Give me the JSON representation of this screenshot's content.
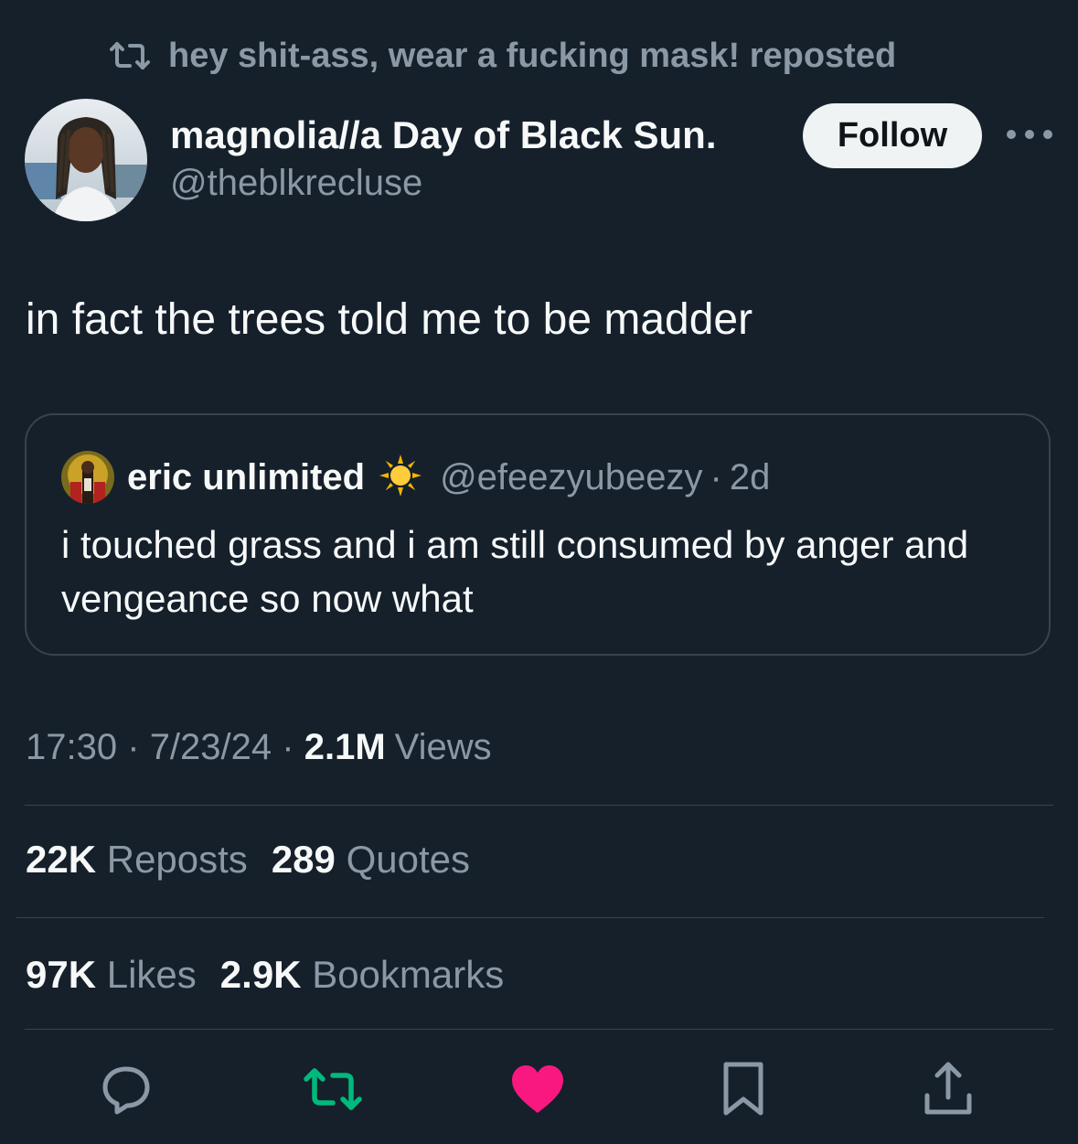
{
  "repost_banner": {
    "text": "hey shit-ass, wear a fucking mask! reposted",
    "icon": "repost-icon"
  },
  "author": {
    "display_name": "magnolia//a Day of Black Sun.",
    "handle": "@theblkrecluse",
    "avatar": "avatar"
  },
  "follow_button": {
    "label": "Follow"
  },
  "more_icon": "more-dots-icon",
  "tweet": {
    "text": "in fact the trees told me to be madder"
  },
  "quoted_tweet": {
    "display_name": "eric unlimited",
    "emoji": "sun-emoji",
    "handle": "@efeezyubeezy",
    "dot": "·",
    "time": "2d",
    "text": "i touched grass and i am still consumed by anger and vengeance so now what"
  },
  "meta": {
    "time": "17:30",
    "sep1": "·",
    "date": "7/23/24",
    "sep2": "·",
    "views_count": "2.1M",
    "views_label": "Views"
  },
  "stats": {
    "reposts_count": "22K",
    "reposts_label": "Reposts",
    "quotes_count": "289",
    "quotes_label": "Quotes",
    "likes_count": "97K",
    "likes_label": "Likes",
    "bookmarks_count": "2.9K",
    "bookmarks_label": "Bookmarks"
  },
  "actions": [
    "reply-icon",
    "repost-icon",
    "like-icon",
    "bookmark-icon",
    "share-icon"
  ],
  "colors": {
    "background": "#15202b",
    "text_primary": "#f7f9f9",
    "text_secondary": "#8b98a5",
    "border": "#38444d",
    "repost_active": "#00ba7c",
    "like_active": "#f91880",
    "follow_bg": "#eff3f4"
  }
}
